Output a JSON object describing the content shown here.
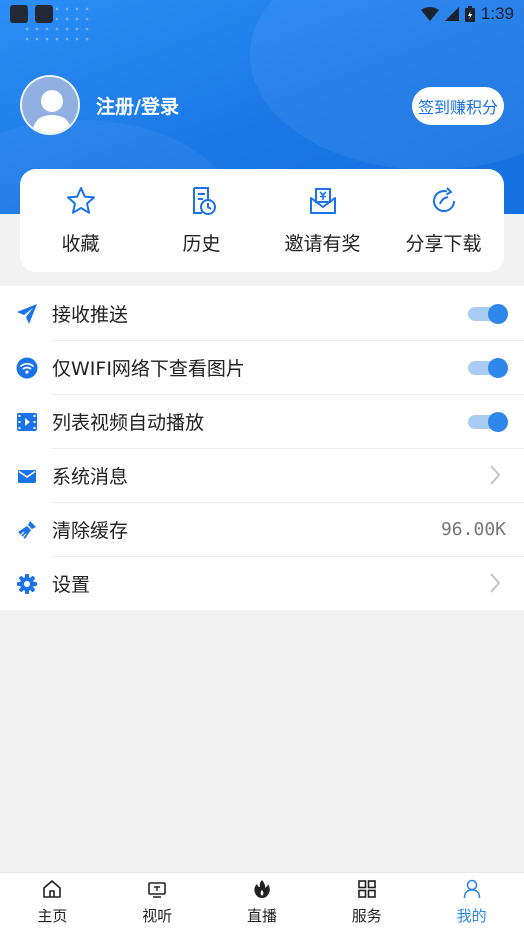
{
  "status_bar": {
    "time": "1:39"
  },
  "profile": {
    "login_text": "注册/登录",
    "sign_in_button": "签到赚积分"
  },
  "quick_actions": [
    {
      "label": "收藏",
      "icon": "star-icon"
    },
    {
      "label": "历史",
      "icon": "history-icon"
    },
    {
      "label": "邀请有奖",
      "icon": "invite-reward-icon"
    },
    {
      "label": "分享下载",
      "icon": "share-icon"
    }
  ],
  "settings": [
    {
      "label": "接收推送",
      "icon": "paper-plane-icon",
      "control": "toggle",
      "on": true
    },
    {
      "label": "仅WIFI网络下查看图片",
      "icon": "wifi-icon",
      "control": "toggle",
      "on": true
    },
    {
      "label": "列表视频自动播放",
      "icon": "film-icon",
      "control": "toggle",
      "on": true
    },
    {
      "label": "系统消息",
      "icon": "mail-icon",
      "control": "chevron"
    },
    {
      "label": "清除缓存",
      "icon": "broom-icon",
      "control": "value",
      "value": "96.00K"
    },
    {
      "label": "设置",
      "icon": "gear-icon",
      "control": "chevron"
    }
  ],
  "tabs": [
    {
      "label": "主页",
      "icon": "home-icon",
      "active": false
    },
    {
      "label": "视听",
      "icon": "tv-icon",
      "active": false
    },
    {
      "label": "直播",
      "icon": "flame-icon",
      "active": false
    },
    {
      "label": "服务",
      "icon": "grid-icon",
      "active": false
    },
    {
      "label": "我的",
      "icon": "user-icon",
      "active": true
    }
  ],
  "colors": {
    "primary": "#1a78e6",
    "accent": "#2f87ea",
    "background": "#f2f2f2"
  }
}
